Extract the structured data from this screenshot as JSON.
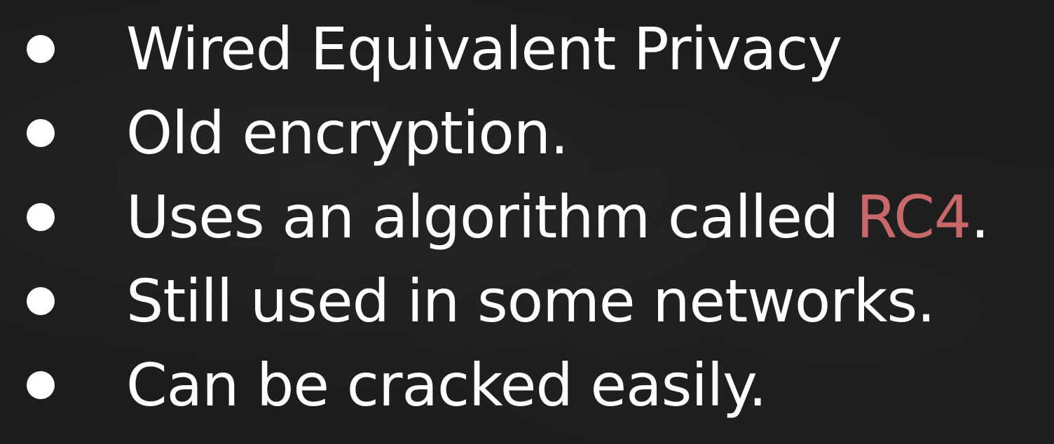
{
  "colors": {
    "background": "#1c1c1c",
    "text": "#ffffff",
    "highlight": "#c9686b"
  },
  "bullets": [
    {
      "text": "Wired Equivalent Privacy"
    },
    {
      "text": "Old encryption."
    },
    {
      "before": "Uses an algorithm called ",
      "highlight": "RC4",
      "after": "."
    },
    {
      "text": "Still used in some networks."
    },
    {
      "text": "Can be cracked easily."
    }
  ]
}
